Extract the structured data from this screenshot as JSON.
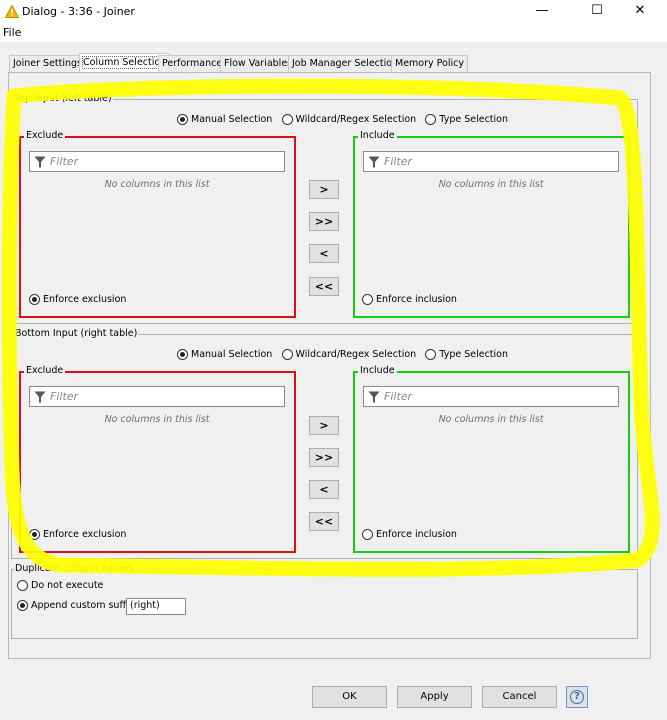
{
  "window": {
    "title": "Dialog - 3:36 - Joiner",
    "minimize": "—",
    "maximize": "☐",
    "close": "✕",
    "icon": "warning-triangle-icon",
    "accent": "#e8b800"
  },
  "menu": {
    "file": "File"
  },
  "tabs": [
    {
      "label": "Joiner Settings",
      "active": false
    },
    {
      "label": "Column Selection",
      "active": true
    },
    {
      "label": "Performance",
      "active": false
    },
    {
      "label": "Flow Variables",
      "active": false
    },
    {
      "label": "Job Manager Selection",
      "active": false
    },
    {
      "label": "Memory Policy",
      "active": false
    }
  ],
  "top_input": {
    "title": "Top Input (left table)",
    "modes": [
      "Manual Selection",
      "Wildcard/Regex Selection",
      "Type Selection"
    ],
    "selected_mode": "Manual Selection",
    "exclude": {
      "title": "Exclude",
      "filter_placeholder": "Filter",
      "empty": "No columns in this list",
      "enforce": "Enforce exclusion",
      "enforce_selected": true,
      "border": "#e01010"
    },
    "include": {
      "title": "Include",
      "filter_placeholder": "Filter",
      "empty": "No columns in this list",
      "enforce": "Enforce inclusion",
      "enforce_selected": false,
      "border": "#16cc16"
    },
    "buttons": [
      ">",
      ">>",
      "<",
      "<<"
    ]
  },
  "bottom_input": {
    "title": "Bottom Input (right table)",
    "modes": [
      "Manual Selection",
      "Wildcard/Regex Selection",
      "Type Selection"
    ],
    "selected_mode": "Manual Selection",
    "exclude": {
      "title": "Exclude",
      "filter_placeholder": "Filter",
      "empty": "No columns in this list",
      "enforce": "Enforce exclusion",
      "enforce_selected": true,
      "border": "#e01010"
    },
    "include": {
      "title": "Include",
      "filter_placeholder": "Filter",
      "empty": "No columns in this list",
      "enforce": "Enforce inclusion",
      "enforce_selected": false,
      "border": "#16cc16"
    },
    "buttons": [
      ">",
      ">>",
      "<",
      "<<"
    ]
  },
  "duplicates": {
    "title": "Duplicate column names",
    "option1": "Do not execute",
    "option2": "Append custom suffix",
    "selected": "Append custom suffix",
    "suffix_value": "(right)"
  },
  "footer": {
    "ok": "OK",
    "apply": "Apply",
    "cancel": "Cancel",
    "help_icon": "help-icon",
    "help_glyph": "?"
  },
  "annotation": {
    "color": "#ffff00"
  }
}
